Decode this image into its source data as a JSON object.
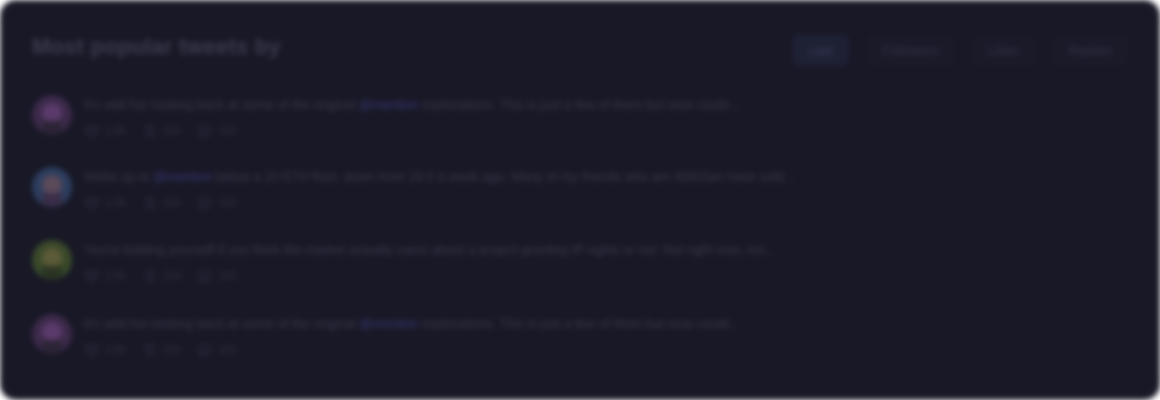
{
  "header": {
    "title": "Most popular tweets by"
  },
  "tabs": [
    {
      "label": "Last",
      "active": true
    },
    {
      "label": "Followers",
      "active": false
    },
    {
      "label": "Likes",
      "active": false
    },
    {
      "label": "Replies",
      "active": false
    }
  ],
  "tweets": [
    {
      "text_before": "It’s wild fun looking back at some of the original ",
      "mention": "@mention",
      "text_after": " explorations. This is just a few of them but wow could...",
      "likes": "1.6k",
      "retweets": "234",
      "replies": "162",
      "avatar_colors": [
        "#3c2a4a",
        "#5a3a6a",
        "#2c2436"
      ]
    },
    {
      "text_before": "Woke up to ",
      "mention": "@mention",
      "text_after": " below a 10 ETH floor, down from 19.5 a week ago. Many of my friends who are #DEGen have sold...",
      "likes": "1.5k",
      "retweets": "234",
      "replies": "162",
      "avatar_colors": [
        "#2c3e5e",
        "#5a4a5a",
        "#3a2e4a"
      ]
    },
    {
      "text_before": "You’re kidding yourself if you think the market actually cares about a project granting IP rights or not.  Not right now, not...",
      "mention": "",
      "text_after": "",
      "likes": "1.5k",
      "retweets": "234",
      "replies": "162",
      "avatar_colors": [
        "#3a4a2a",
        "#5c5a38",
        "#2a3422"
      ]
    },
    {
      "text_before": "It’s wild fun looking back at some of the original ",
      "mention": "@mention",
      "text_after": " explorations. This is just a few of them but wow could...",
      "likes": "1.6k",
      "retweets": "234",
      "replies": "162",
      "avatar_colors": [
        "#3c2a4a",
        "#5a3a6a",
        "#2c2436"
      ]
    }
  ]
}
